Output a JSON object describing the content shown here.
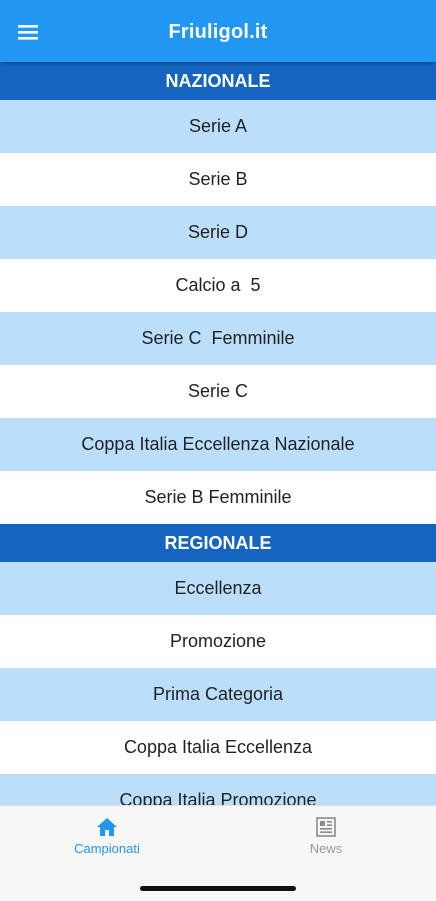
{
  "appbar": {
    "title": "Friuligol.it",
    "menu_icon": "menu-icon"
  },
  "sections": {
    "nazionale": {
      "title": "NAZIONALE",
      "items": [
        "Serie A",
        "Serie B",
        "Serie D",
        "Calcio a  5",
        "Serie C  Femminile",
        "Serie C",
        "Coppa Italia Eccellenza Nazionale",
        "Serie B Femminile"
      ]
    },
    "regionale": {
      "title": "REGIONALE",
      "items": [
        "Eccellenza",
        "Promozione",
        "Prima Categoria",
        "Coppa Italia Eccellenza",
        "Coppa Italia Promozione"
      ]
    }
  },
  "tabs": [
    {
      "label": "Campionati",
      "icon": "home-icon",
      "active": true
    },
    {
      "label": "News",
      "icon": "newspaper-icon",
      "active": false
    }
  ],
  "colors": {
    "appbar": "#2196f3",
    "section_header": "#1565c0",
    "row_alt": "#bbdefb",
    "active_tab": "#2196f3"
  }
}
